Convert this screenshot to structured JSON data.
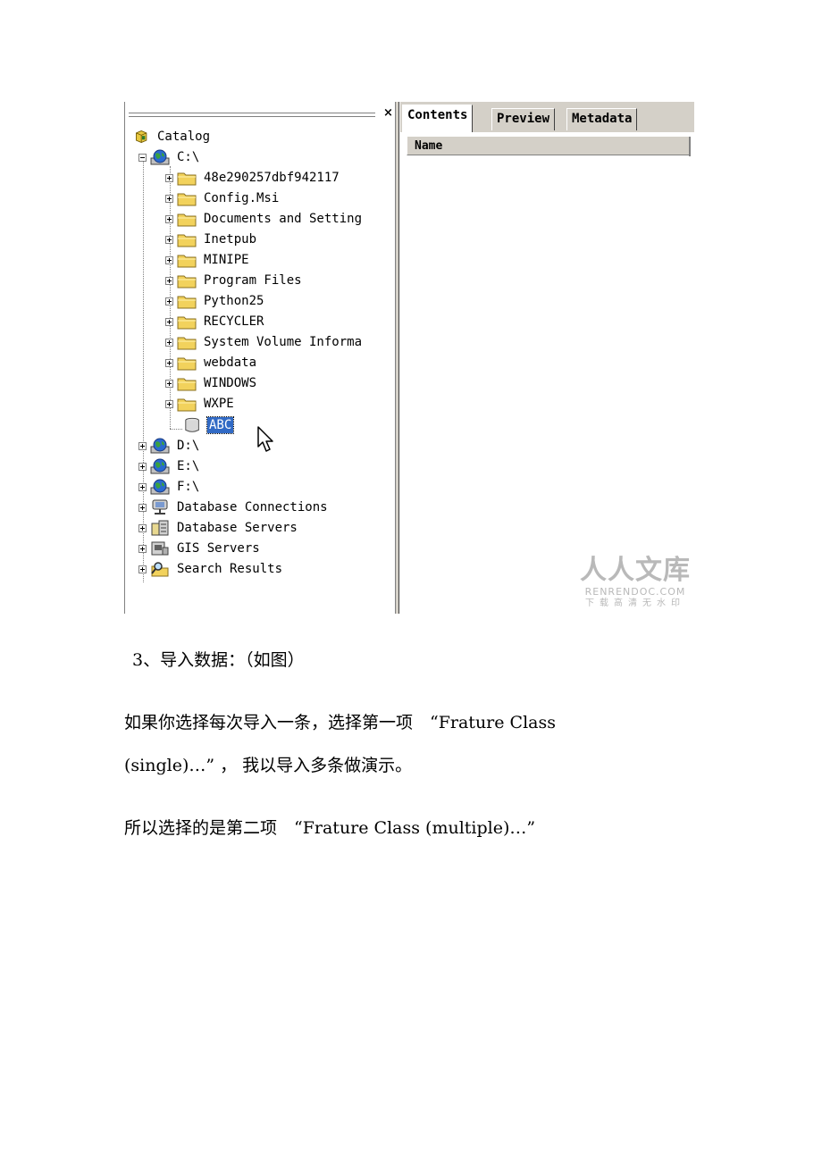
{
  "catalog_panel": {
    "close_glyph": "×",
    "tree": [
      {
        "label": "Catalog",
        "icon": "catalog-icon"
      },
      {
        "label": "C:\\",
        "icon": "drive-globe-icon"
      },
      {
        "label": "48e290257dbf942117",
        "icon": "folder-icon"
      },
      {
        "label": "Config.Msi",
        "icon": "folder-icon"
      },
      {
        "label": "Documents and Setting",
        "icon": "folder-icon"
      },
      {
        "label": "Inetpub",
        "icon": "folder-icon"
      },
      {
        "label": "MINIPE",
        "icon": "folder-icon"
      },
      {
        "label": "Program Files",
        "icon": "folder-icon"
      },
      {
        "label": "Python25",
        "icon": "folder-icon"
      },
      {
        "label": "RECYCLER",
        "icon": "folder-icon"
      },
      {
        "label": "System Volume Informa",
        "icon": "folder-icon"
      },
      {
        "label": "webdata",
        "icon": "folder-icon"
      },
      {
        "label": "WINDOWS",
        "icon": "folder-icon"
      },
      {
        "label": "WXPE",
        "icon": "folder-icon"
      },
      {
        "label": "ABC",
        "icon": "database-icon"
      },
      {
        "label": "D:\\",
        "icon": "drive-globe-icon"
      },
      {
        "label": "E:\\",
        "icon": "drive-globe-icon"
      },
      {
        "label": "F:\\",
        "icon": "drive-globe-icon"
      },
      {
        "label": "Database Connections",
        "icon": "database-connections-icon"
      },
      {
        "label": "Database Servers",
        "icon": "database-servers-icon"
      },
      {
        "label": "GIS Servers",
        "icon": "gis-servers-icon"
      },
      {
        "label": "Search Results",
        "icon": "search-results-icon"
      }
    ]
  },
  "content_panel": {
    "tabs": [
      "Contents",
      "Preview",
      "Metadata"
    ],
    "active_tab": "Contents",
    "column_header": "Name"
  },
  "watermark": {
    "main": "人人文库",
    "url": "RENRENDOC.COM",
    "sub": "下载高清无水印"
  },
  "paragraphs": {
    "step": "3、导入数据：（如图）",
    "line1": "如果你选择每次导入一条，选择第一项　“Frature Class",
    "line2": "(single)…” ， 我以导入多条做演示。",
    "line3": "所以选择的是第二项　“Frature Class (multiple)…”"
  }
}
